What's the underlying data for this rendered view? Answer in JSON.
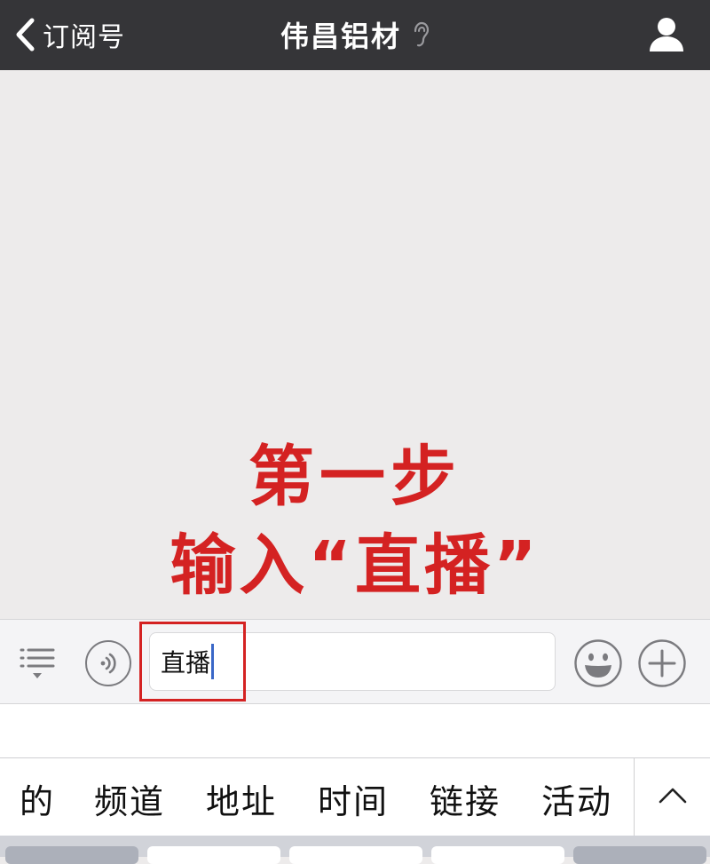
{
  "navbar": {
    "back_label": "订阅号",
    "title": "伟昌铝材"
  },
  "overlay": {
    "line1": "第一步",
    "line2": "输入“直播”"
  },
  "input": {
    "value": "直播"
  },
  "candidates": [
    "的",
    "频道",
    "地址",
    "时间",
    "链接",
    "活动"
  ],
  "colors": {
    "navbar_bg": "#353538",
    "chat_bg": "#edebeb",
    "annotation_red": "#d42222",
    "caret_blue": "#3a67c7"
  },
  "icons": {
    "back": "chevron-left-icon",
    "title_badge": "ear-icon",
    "profile": "user-icon",
    "menu": "menu-list-icon",
    "voice": "voice-icon",
    "emoji": "emoji-icon",
    "plus": "plus-icon",
    "expand": "chevron-up-icon"
  }
}
